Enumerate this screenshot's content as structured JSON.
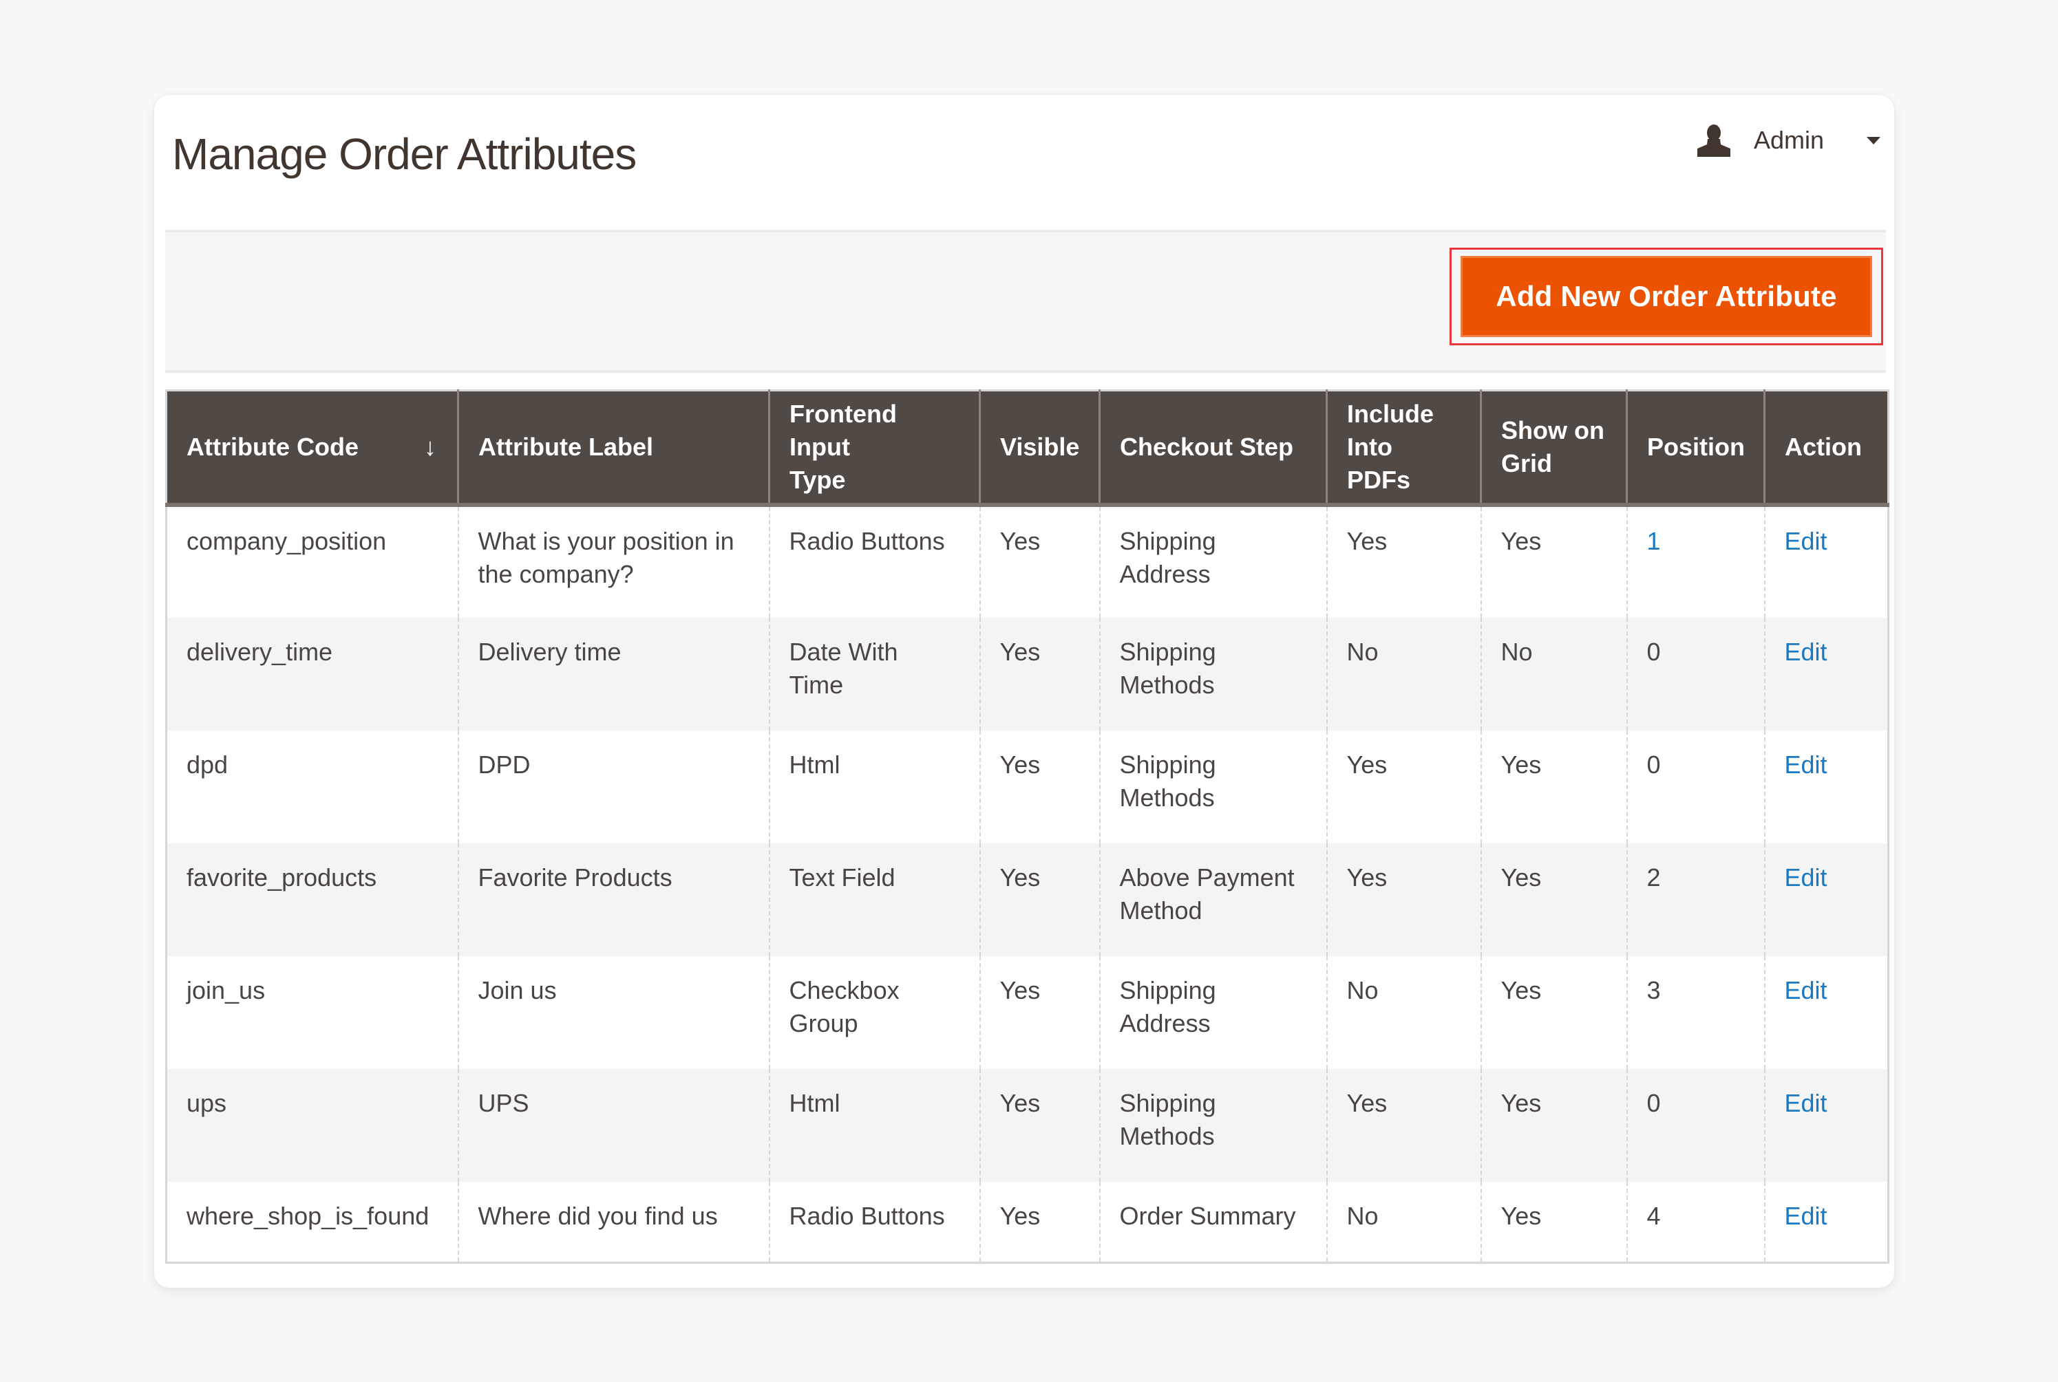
{
  "header": {
    "title": "Manage Order Attributes",
    "user": {
      "name": "Admin",
      "icon": "user-icon",
      "dropdown_icon": "caret-down-icon"
    }
  },
  "actions": {
    "add_button_label": "Add New Order Attribute"
  },
  "colors": {
    "header_bg": "#514943",
    "accent_orange": "#eb5202",
    "highlight_border": "#e8383d",
    "link_blue": "#1979c3"
  },
  "grid": {
    "sort_column": "Attribute Code",
    "sort_icon": "sort-arrow-down-icon",
    "columns": [
      "Attribute Code",
      "Attribute Label",
      "Frontend Input Type",
      "Visible",
      "Checkout Step",
      "Include Into PDFs",
      "Show on Grid",
      "Position",
      "Action"
    ],
    "rows": [
      {
        "code": "company_position",
        "label": "What is your position in the company?",
        "input_type": "Radio Buttons",
        "visible": "Yes",
        "checkout_step": "Shipping Address",
        "include_pdfs": "Yes",
        "show_grid": "Yes",
        "position": "1",
        "action": "Edit"
      },
      {
        "code": "delivery_time",
        "label": "Delivery time",
        "input_type": "Date With Time",
        "visible": "Yes",
        "checkout_step": "Shipping Methods",
        "include_pdfs": "No",
        "show_grid": "No",
        "position": "0",
        "action": "Edit"
      },
      {
        "code": "dpd",
        "label": "DPD",
        "input_type": "Html",
        "visible": "Yes",
        "checkout_step": "Shipping Methods",
        "include_pdfs": "Yes",
        "show_grid": "Yes",
        "position": "0",
        "action": "Edit"
      },
      {
        "code": "favorite_products",
        "label": "Favorite Products",
        "input_type": "Text Field",
        "visible": "Yes",
        "checkout_step": "Above Payment Method",
        "include_pdfs": "Yes",
        "show_grid": "Yes",
        "position": "2",
        "action": "Edit"
      },
      {
        "code": "join_us",
        "label": "Join us",
        "input_type": "Checkbox Group",
        "visible": "Yes",
        "checkout_step": "Shipping Address",
        "include_pdfs": "No",
        "show_grid": "Yes",
        "position": "3",
        "action": "Edit"
      },
      {
        "code": "ups",
        "label": "UPS",
        "input_type": "Html",
        "visible": "Yes",
        "checkout_step": "Shipping Methods",
        "include_pdfs": "Yes",
        "show_grid": "Yes",
        "position": "0",
        "action": "Edit"
      },
      {
        "code": "where_shop_is_found",
        "label": "Where did you find us",
        "input_type": "Radio Buttons",
        "visible": "Yes",
        "checkout_step": "Order Summary",
        "include_pdfs": "No",
        "show_grid": "Yes",
        "position": "4",
        "action": "Edit"
      }
    ]
  }
}
